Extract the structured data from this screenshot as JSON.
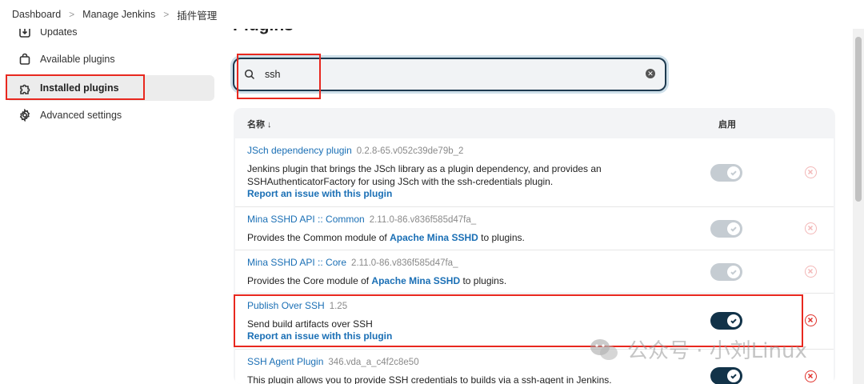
{
  "breadcrumb": {
    "items": [
      "Dashboard",
      "Manage Jenkins",
      "插件管理"
    ]
  },
  "sidebar": {
    "items": [
      {
        "label": "Updates",
        "icon": "download-icon"
      },
      {
        "label": "Available plugins",
        "icon": "shopping-bag-icon"
      },
      {
        "label": "Installed plugins",
        "icon": "puzzle-icon",
        "active": true
      },
      {
        "label": "Advanced settings",
        "icon": "gear-icon"
      }
    ]
  },
  "main": {
    "title": "Plugins",
    "search": {
      "value": "ssh",
      "placeholder": ""
    }
  },
  "table": {
    "headers": {
      "name": "名称 ↓",
      "enabled": "启用"
    },
    "rows": [
      {
        "name": "JSch dependency plugin",
        "version": "0.2.8-65.v052c39de79b_2",
        "desc": "Jenkins plugin that brings the JSch library as a plugin dependency, and provides an SSHAuthenticatorFactory for using JSch with the ssh-credentials plugin.",
        "report": "Report an issue with this plugin",
        "enabled": true,
        "locked": true
      },
      {
        "name": "Mina SSHD API :: Common",
        "version": "2.11.0-86.v836f585d47fa_",
        "desc_pre": "Provides the Common module of ",
        "desc_link": "Apache Mina SSHD",
        "desc_post": " to plugins.",
        "enabled": true,
        "locked": true
      },
      {
        "name": "Mina SSHD API :: Core",
        "version": "2.11.0-86.v836f585d47fa_",
        "desc_pre": "Provides the Core module of ",
        "desc_link": "Apache Mina SSHD",
        "desc_post": " to plugins.",
        "enabled": true,
        "locked": true
      },
      {
        "name": "Publish Over SSH",
        "version": "1.25",
        "desc": "Send build artifacts over SSH",
        "report": "Report an issue with this plugin",
        "enabled": true,
        "locked": false
      },
      {
        "name": "SSH Agent Plugin",
        "version": "346.vda_a_c4f2c8e50",
        "desc": "This plugin allows you to provide SSH credentials to builds via a ssh-agent in Jenkins.",
        "enabled": true,
        "locked": false
      }
    ]
  },
  "colors": {
    "link": "#1a6fb5",
    "toggle_on": "#123349",
    "toggle_disabled": "#c5ccd2",
    "uninstall": "#e0302a",
    "annotation": "#e8281f"
  },
  "watermark": {
    "text": "公众号 · 小刘Linux"
  }
}
